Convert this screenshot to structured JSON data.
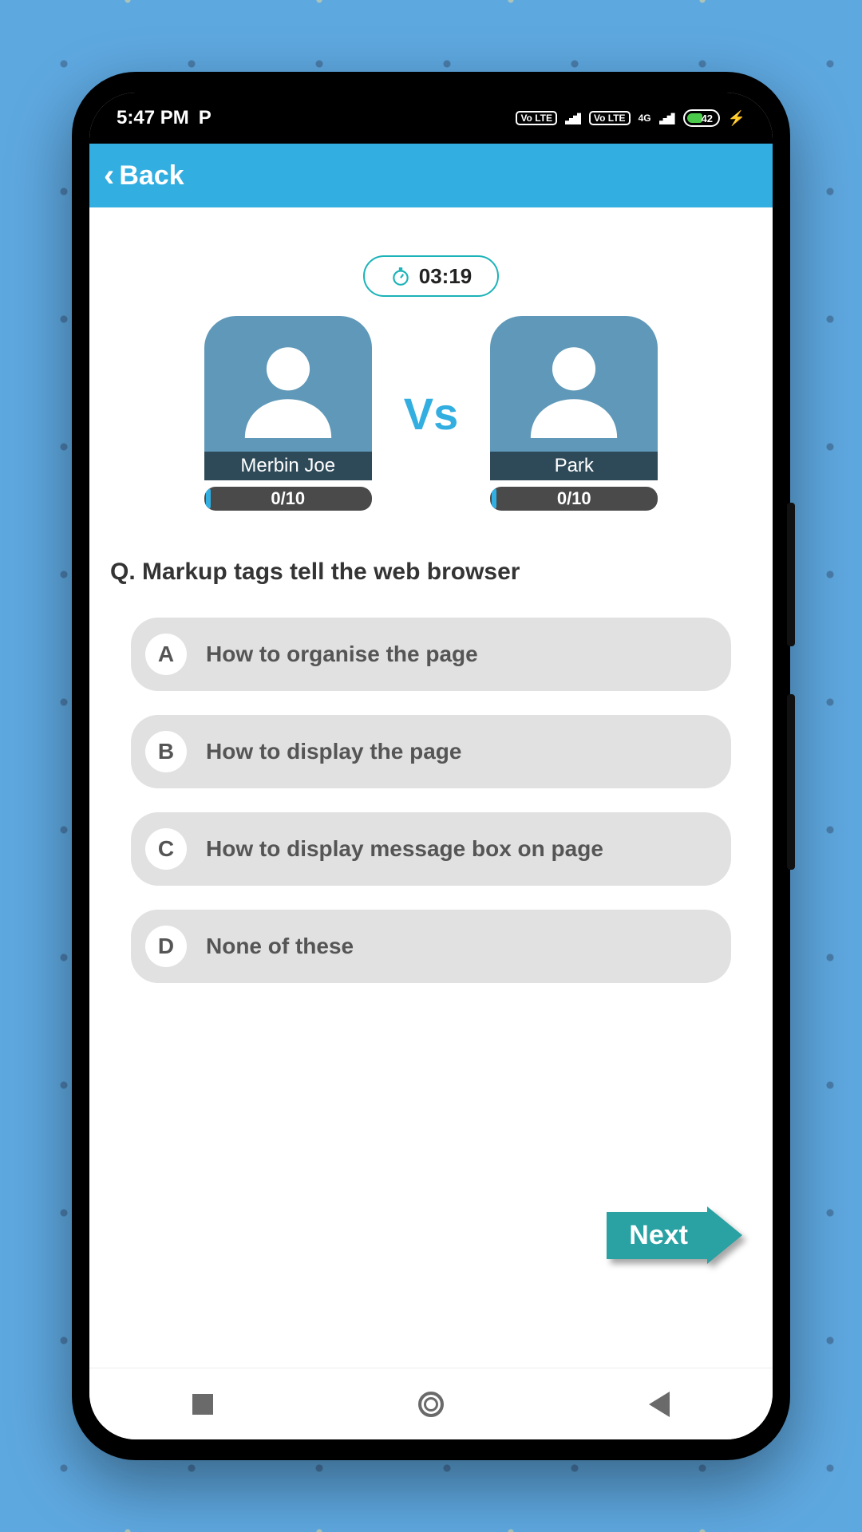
{
  "statusbar": {
    "time": "5:47 PM",
    "battery": "42",
    "network_label_1": "Vo LTE",
    "network_label_2": "Vo LTE",
    "network_label_3": "4G"
  },
  "appbar": {
    "back_label": "Back"
  },
  "timer": {
    "value": "03:19"
  },
  "vs_label": "Vs",
  "players": [
    {
      "name": "Merbin Joe",
      "score": "0/10"
    },
    {
      "name": "Park",
      "score": "0/10"
    }
  ],
  "question": {
    "prefix": "Q. ",
    "text": "Markup tags tell the web browser"
  },
  "answers": [
    {
      "letter": "A",
      "text": "How to organise the page"
    },
    {
      "letter": "B",
      "text": "How to display the page"
    },
    {
      "letter": "C",
      "text": "How to display message box on page"
    },
    {
      "letter": "D",
      "text": "None of these"
    }
  ],
  "next_label": "Next"
}
